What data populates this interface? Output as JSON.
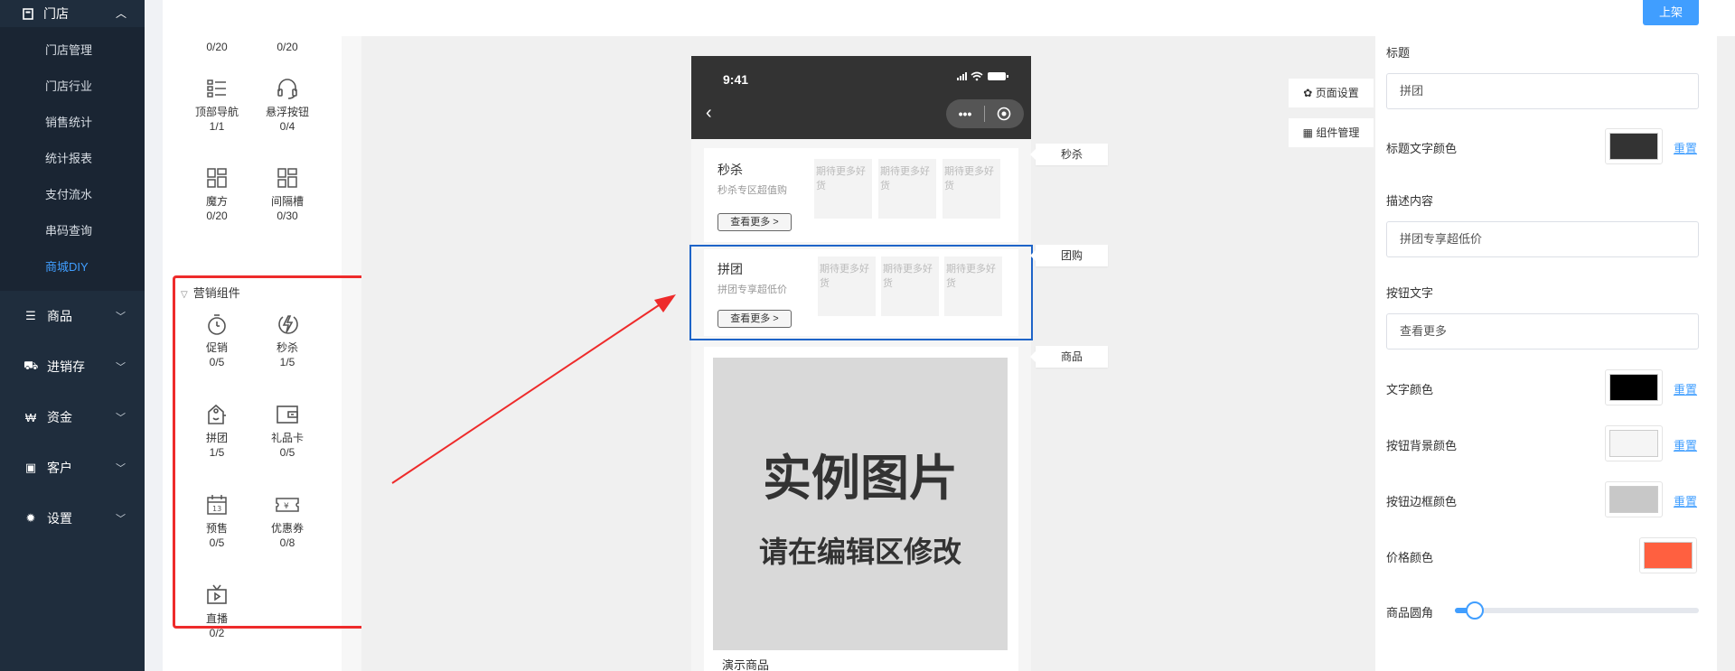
{
  "nav": {
    "top": {
      "label": "门店",
      "icon": "store-icon"
    },
    "sub_items": [
      {
        "label": "门店管理",
        "active": false
      },
      {
        "label": "门店行业",
        "active": false
      },
      {
        "label": "销售统计",
        "active": false
      },
      {
        "label": "统计报表",
        "active": false
      },
      {
        "label": "支付流水",
        "active": false
      },
      {
        "label": "串码查询",
        "active": false
      },
      {
        "label": "商城DIY",
        "active": true
      }
    ],
    "groups": [
      {
        "label": "商品",
        "icon": "menu-icon"
      },
      {
        "label": "进销存",
        "icon": "truck-icon"
      },
      {
        "label": "资金",
        "icon": "won-icon"
      },
      {
        "label": "客户",
        "icon": "id-card-icon"
      },
      {
        "label": "设置",
        "icon": "gear-icon"
      }
    ]
  },
  "panel": {
    "top_counts": [
      "0/20",
      "0/20"
    ],
    "basic": [
      {
        "name": "顶部导航",
        "count": "1/1",
        "icon": "list-icon"
      },
      {
        "name": "悬浮按钮",
        "count": "0/4",
        "icon": "headset-icon"
      },
      {
        "name": "魔方",
        "count": "0/20",
        "icon": "grid-icon"
      },
      {
        "name": "间隔槽",
        "count": "0/30",
        "icon": "grid-icon"
      }
    ],
    "marketing_title": "营销组件",
    "marketing": [
      {
        "name": "促销",
        "count": "0/5",
        "icon": "stopwatch-icon"
      },
      {
        "name": "秒杀",
        "count": "1/5",
        "icon": "lightning-icon"
      },
      {
        "name": "拼团",
        "count": "1/5",
        "icon": "tag-icon"
      },
      {
        "name": "礼品卡",
        "count": "0/5",
        "icon": "wallet-icon"
      },
      {
        "name": "预售",
        "count": "0/5",
        "icon": "calendar-icon"
      },
      {
        "name": "优惠券",
        "count": "0/8",
        "icon": "coupon-icon"
      },
      {
        "name": "直播",
        "count": "0/2",
        "icon": "tv-play-icon"
      }
    ]
  },
  "toolbar": {
    "publish_label": "上架"
  },
  "phone": {
    "time": "9:41",
    "seckill": {
      "title": "秒杀",
      "desc": "秒杀专区超值购",
      "button": "查看更多 >",
      "placeholders": [
        "期待更多好货",
        "期待更多好货",
        "期待更多好货"
      ]
    },
    "group": {
      "title": "拼团",
      "desc": "拼团专享超低价",
      "button": "查看更多 >",
      "placeholders": [
        "期待更多好货",
        "期待更多好货",
        "期待更多好货"
      ]
    },
    "goods": {
      "image_line1": "实例图片",
      "image_line2": "请在编辑区修改",
      "name": "演示商品"
    }
  },
  "tags": [
    "秒杀",
    "团购",
    "商品"
  ],
  "side_buttons": {
    "page_settings": "页面设置",
    "component_manage": "组件管理"
  },
  "props": {
    "title_label": "标题",
    "title_value": "拼团",
    "title_color_label": "标题文字颜色",
    "title_color": "#333333",
    "desc_label": "描述内容",
    "desc_value": "拼团专享超低价",
    "button_text_label": "按钮文字",
    "button_text_value": "查看更多",
    "text_color_label": "文字颜色",
    "text_color": "#000000",
    "btn_bg_label": "按钮背景颜色",
    "btn_bg_color": "#f5f5f5",
    "btn_border_label": "按钮边框颜色",
    "btn_border_color": "#c8c8c8",
    "price_color_label": "价格颜色",
    "price_color": "#ff6040",
    "radius_label": "商品圆角",
    "radius_value_fraction": 0.08,
    "reset_label": "重置"
  },
  "colors": {
    "nav_bg": "#1f2d3d",
    "accent": "#409eff",
    "highlight_box": "#ee2b2b",
    "selection": "#1e64c8"
  }
}
